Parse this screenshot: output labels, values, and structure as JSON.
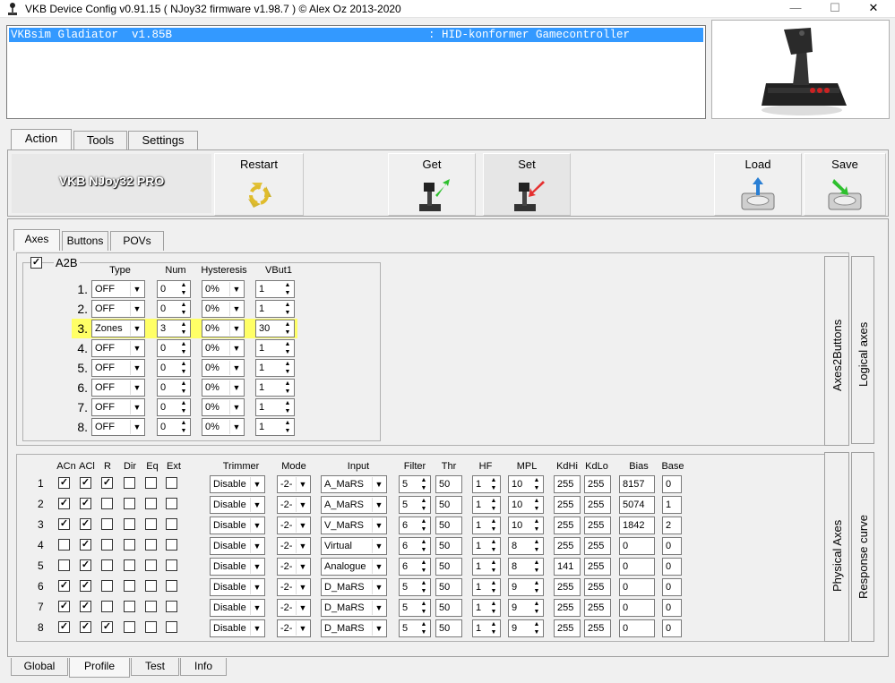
{
  "window": {
    "title": "VKB Device Config v0.91.15 ( NJoy32 firmware v1.98.7 ) © Alex Oz 2013-2020"
  },
  "device": {
    "name": "VKBsim Gladiator  v1.85B",
    "type": ": HID-konformer Gamecontroller"
  },
  "main_tabs": [
    "Action",
    "Tools",
    "Settings"
  ],
  "toolbar": {
    "brand": "VKB NJoy32 PRO",
    "restart": "Restart",
    "get": "Get",
    "set": "Set",
    "load": "Load",
    "save": "Save"
  },
  "sub_tabs": [
    "Axes",
    "Buttons",
    "POVs"
  ],
  "a2b": {
    "label": "A2B",
    "enabled": true,
    "headers": [
      "Type",
      "Num",
      "Hysteresis",
      "VBut1"
    ],
    "rows": [
      {
        "n": "1.",
        "type": "OFF",
        "num": "0",
        "hyst": "0%",
        "vbut": "1"
      },
      {
        "n": "2.",
        "type": "OFF",
        "num": "0",
        "hyst": "0%",
        "vbut": "1"
      },
      {
        "n": "3.",
        "type": "Zones",
        "num": "3",
        "hyst": "0%",
        "vbut": "30"
      },
      {
        "n": "4.",
        "type": "OFF",
        "num": "0",
        "hyst": "0%",
        "vbut": "1"
      },
      {
        "n": "5.",
        "type": "OFF",
        "num": "0",
        "hyst": "0%",
        "vbut": "1"
      },
      {
        "n": "6.",
        "type": "OFF",
        "num": "0",
        "hyst": "0%",
        "vbut": "1"
      },
      {
        "n": "7.",
        "type": "OFF",
        "num": "0",
        "hyst": "0%",
        "vbut": "1"
      },
      {
        "n": "8.",
        "type": "OFF",
        "num": "0",
        "hyst": "0%",
        "vbut": "1"
      }
    ],
    "highlight_color": "#ffff66"
  },
  "side_tabs_top": [
    "Axes2Buttons",
    "Logical axes"
  ],
  "side_tabs_bottom": [
    "Physical Axes",
    "Response curve"
  ],
  "phys": {
    "headers": [
      "ACn",
      "ACl",
      "R",
      "Dir",
      "Eq",
      "Ext",
      "Trimmer",
      "Mode",
      "Input",
      "Filter",
      "Thr",
      "HF",
      "MPL",
      "KdHi",
      "KdLo",
      "Bias",
      "Base"
    ],
    "rows": [
      {
        "n": "1",
        "acn": true,
        "acl": true,
        "r": true,
        "dir": false,
        "eq": false,
        "ext": false,
        "trimmer": "Disable",
        "mode": "-2-",
        "input": "A_MaRS",
        "filter": "5",
        "thr": "50",
        "hf": "1",
        "mpl": "10",
        "kdhi": "255",
        "kdlo": "255",
        "bias": "8157",
        "base": "0"
      },
      {
        "n": "2",
        "acn": true,
        "acl": true,
        "r": false,
        "dir": false,
        "eq": false,
        "ext": false,
        "trimmer": "Disable",
        "mode": "-2-",
        "input": "A_MaRS",
        "filter": "5",
        "thr": "50",
        "hf": "1",
        "mpl": "10",
        "kdhi": "255",
        "kdlo": "255",
        "bias": "5074",
        "base": "1"
      },
      {
        "n": "3",
        "acn": true,
        "acl": true,
        "r": false,
        "dir": false,
        "eq": false,
        "ext": false,
        "trimmer": "Disable",
        "mode": "-2-",
        "input": "V_MaRS",
        "filter": "6",
        "thr": "50",
        "hf": "1",
        "mpl": "10",
        "kdhi": "255",
        "kdlo": "255",
        "bias": "1842",
        "base": "2"
      },
      {
        "n": "4",
        "acn": false,
        "acl": true,
        "r": false,
        "dir": false,
        "eq": false,
        "ext": false,
        "trimmer": "Disable",
        "mode": "-2-",
        "input": "Virtual",
        "filter": "6",
        "thr": "50",
        "hf": "1",
        "mpl": "8",
        "kdhi": "255",
        "kdlo": "255",
        "bias": "0",
        "base": "0"
      },
      {
        "n": "5",
        "acn": false,
        "acl": true,
        "r": false,
        "dir": false,
        "eq": false,
        "ext": false,
        "trimmer": "Disable",
        "mode": "-2-",
        "input": "Analogue",
        "filter": "6",
        "thr": "50",
        "hf": "1",
        "mpl": "8",
        "kdhi": "141",
        "kdlo": "255",
        "bias": "0",
        "base": "0"
      },
      {
        "n": "6",
        "acn": true,
        "acl": true,
        "r": false,
        "dir": false,
        "eq": false,
        "ext": false,
        "trimmer": "Disable",
        "mode": "-2-",
        "input": "D_MaRS",
        "filter": "5",
        "thr": "50",
        "hf": "1",
        "mpl": "9",
        "kdhi": "255",
        "kdlo": "255",
        "bias": "0",
        "base": "0"
      },
      {
        "n": "7",
        "acn": true,
        "acl": true,
        "r": false,
        "dir": false,
        "eq": false,
        "ext": false,
        "trimmer": "Disable",
        "mode": "-2-",
        "input": "D_MaRS",
        "filter": "5",
        "thr": "50",
        "hf": "1",
        "mpl": "9",
        "kdhi": "255",
        "kdlo": "255",
        "bias": "0",
        "base": "0"
      },
      {
        "n": "8",
        "acn": true,
        "acl": true,
        "r": true,
        "dir": false,
        "eq": false,
        "ext": false,
        "trimmer": "Disable",
        "mode": "-2-",
        "input": "D_MaRS",
        "filter": "5",
        "thr": "50",
        "hf": "1",
        "mpl": "9",
        "kdhi": "255",
        "kdlo": "255",
        "bias": "0",
        "base": "0"
      }
    ]
  },
  "bottom_tabs": [
    "Global",
    "Profile",
    "Test",
    "Info"
  ],
  "colors": {
    "selection": "#3399ff",
    "accent_green": "#2ec02e",
    "accent_red": "#e53030",
    "accent_blue": "#2a7fd4"
  }
}
